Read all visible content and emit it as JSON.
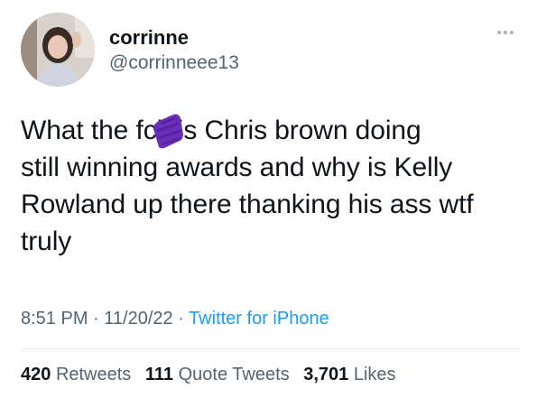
{
  "author": {
    "name": "corrinne",
    "handle": "@corrinneee13"
  },
  "tweet": {
    "text_part1": "What the f",
    "text_censored": "ck",
    "text_part2": " is Chris brown doing",
    "line2": "still winning awards and why is Kelly",
    "line3": "Rowland up there thanking his ass wtf",
    "line4": "truly"
  },
  "meta": {
    "time": "8:51 PM",
    "separator": " · ",
    "date": "11/20/22",
    "source": "Twitter for iPhone"
  },
  "stats": {
    "retweets_count": "420",
    "retweets_label": "Retweets",
    "quotes_count": "111",
    "quotes_label": "Quote Tweets",
    "likes_count": "3,701",
    "likes_label": "Likes"
  },
  "colors": {
    "text": "#0f1419",
    "secondary": "#536471",
    "link": "#1d9bf0",
    "censor": "#6a2fb8"
  },
  "icons": {
    "more": "more-dots-icon",
    "censor": "purple-scribble-redaction"
  }
}
